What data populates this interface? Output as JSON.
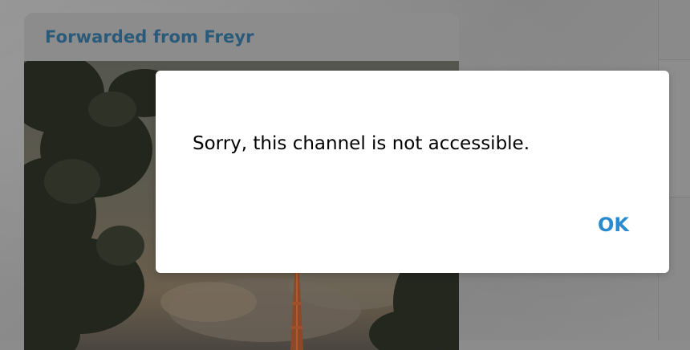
{
  "message": {
    "forwarded_label": "Forwarded from Freyr"
  },
  "dialog": {
    "text": "Sorry, this channel is not accessible.",
    "ok_label": "OK"
  },
  "colors": {
    "accent": "#2a8bd0",
    "forward_header": "#2a5a7a",
    "dialog_bg": "#ffffff"
  }
}
